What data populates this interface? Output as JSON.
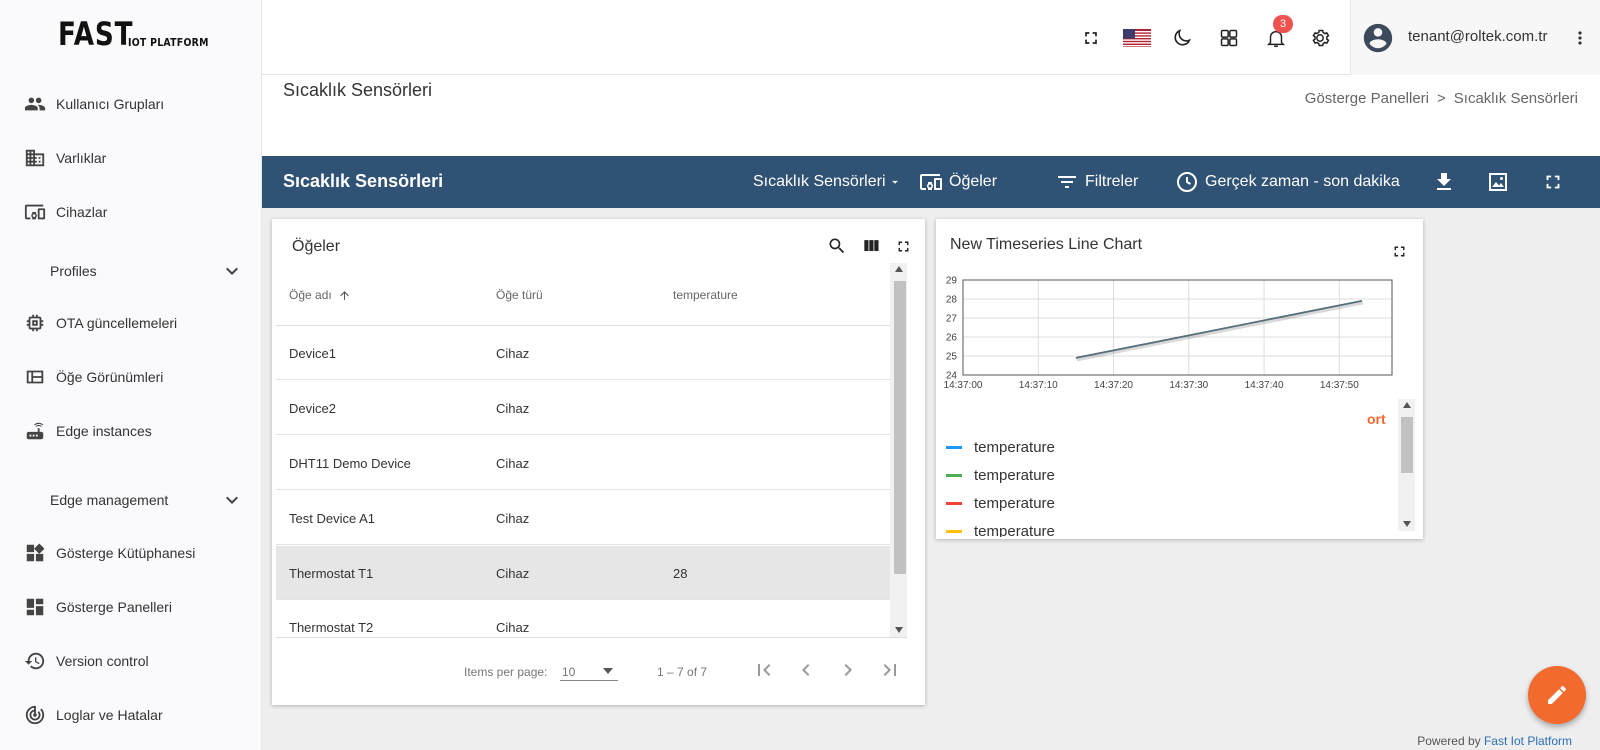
{
  "sidebar": {
    "logo_main": "FAST",
    "logo_sub": "IOT PLATFORM",
    "items": [
      {
        "label": "Kullanıcı Grupları",
        "icon": "user-group-icon"
      },
      {
        "label": "Varlıklar",
        "icon": "building-icon"
      },
      {
        "label": "Cihazlar",
        "icon": "devices-icon"
      },
      {
        "label": "Profiles",
        "icon": "chevron-down-icon"
      },
      {
        "label": "OTA güncellemeleri",
        "icon": "chip-icon"
      },
      {
        "label": "Öğe Görünümleri",
        "icon": "view-quilt-icon"
      },
      {
        "label": "Edge instances",
        "icon": "router-icon"
      },
      {
        "label": "Edge management",
        "icon": "chevron-down-icon"
      },
      {
        "label": "Gösterge Kütüphanesi",
        "icon": "widgets-icon"
      },
      {
        "label": "Gösterge Panelleri",
        "icon": "dashboard-icon"
      },
      {
        "label": "Version control",
        "icon": "history-icon"
      },
      {
        "label": "Loglar ve Hatalar",
        "icon": "track-changes-icon"
      }
    ]
  },
  "header": {
    "notification_count": "3",
    "user_email": "tenant@roltek.com.tr"
  },
  "page": {
    "title": "Sıcaklık Sensörleri",
    "breadcrumb": [
      "Gösterge Panelleri",
      ">",
      "Sıcaklık Sensörleri"
    ]
  },
  "dashboard": {
    "title": "Sıcaklık Sensörleri",
    "state_select": "Sıcaklık Sensörleri",
    "entities_label": "Öğeler",
    "filters_label": "Filtreler",
    "timewindow_label": "Gerçek zaman - son dakika"
  },
  "entities_widget": {
    "title": "Öğeler",
    "columns": [
      "Öğe adı",
      "Öğe türü",
      "temperature"
    ],
    "rows": [
      {
        "name": "Device1",
        "type": "Cihaz",
        "temperature": ""
      },
      {
        "name": "Device2",
        "type": "Cihaz",
        "temperature": ""
      },
      {
        "name": "DHT11 Demo Device",
        "type": "Cihaz",
        "temperature": ""
      },
      {
        "name": "Test Device A1",
        "type": "Cihaz",
        "temperature": ""
      },
      {
        "name": "Thermostat T1",
        "type": "Cihaz",
        "temperature": "28"
      },
      {
        "name": "Thermostat T2",
        "type": "Cihaz",
        "temperature": ""
      }
    ],
    "selected_row": 4,
    "items_per_page_label": "Items per page:",
    "items_per_page": "10",
    "range": "1 – 7 of 7"
  },
  "chart_widget": {
    "title": "New Timeseries Line Chart",
    "legend_header": "ort",
    "legend": [
      {
        "name": "temperature",
        "color": "#2196f3"
      },
      {
        "name": "temperature",
        "color": "#4caf50"
      },
      {
        "name": "temperature",
        "color": "#f44336"
      },
      {
        "name": "temperature",
        "color": "#ffc107"
      }
    ]
  },
  "chart_data": {
    "type": "line",
    "title": "",
    "xlabel": "",
    "ylabel": "",
    "x_ticks": [
      "14:37:00",
      "14:37:10",
      "14:37:20",
      "14:37:30",
      "14:37:40",
      "14:37:50"
    ],
    "x_range": [
      "14:37:00",
      "14:37:57"
    ],
    "y_ticks": [
      "24",
      "25",
      "26",
      "27",
      "28",
      "29"
    ],
    "ylim": [
      24,
      29
    ],
    "grid": true,
    "series": [
      {
        "color": "#546e7a",
        "points": [
          {
            "x": "14:37:15",
            "y": 24.9
          },
          {
            "x": "14:37:53",
            "y": 27.9
          }
        ]
      }
    ]
  },
  "footer": {
    "powered_prefix": "Powered by",
    "powered_name": "Fast Iot Platform"
  },
  "colors": {
    "toolbar": "#2f5275",
    "fab": "#f26a2e",
    "accent_legend": "#f26a2e"
  }
}
